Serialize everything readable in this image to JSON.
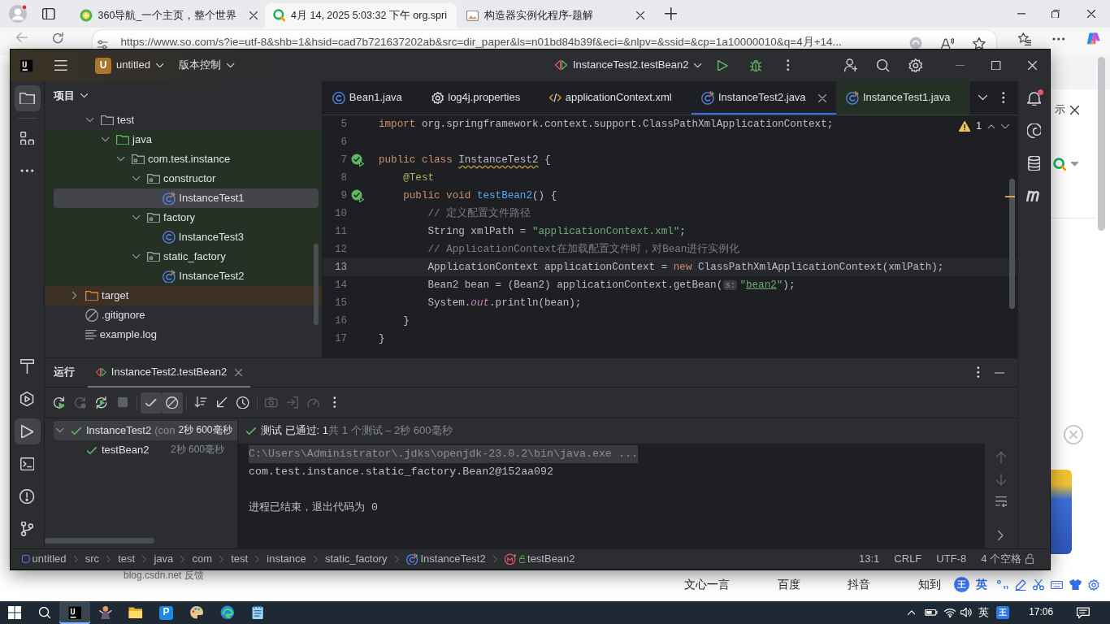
{
  "browser": {
    "tabs": [
      {
        "title": "360导航_一个主页，整个世界",
        "kind": "round",
        "selected": false
      },
      {
        "title": "4月 14, 2025 5:03:32 下午 org.spri",
        "kind": "ring",
        "selected": true
      },
      {
        "title": "构造器实例化程序-题解",
        "kind": "image",
        "selected": false
      }
    ],
    "address": "https://www.so.com/s?ie=utf-8&shb=1&hsid=cad7b721637202ab&src=dir_paper&ls=n01bd84b39f&eci=&nlpv=&ssid=&cp=1a10000010&q=4月+14..."
  },
  "ide": {
    "title_bar": {
      "project_badge": "U",
      "project": "untitled",
      "vcs": "版本控制",
      "run_config": "InstanceTest2.testBean2"
    },
    "left_tools": [
      {
        "kind": "project",
        "selected": true
      },
      {
        "kind": "structure",
        "selected": false
      },
      {
        "kind": "more",
        "selected": false
      }
    ],
    "left_tools_bottom": [
      {
        "kind": "build",
        "selected": false
      },
      {
        "kind": "services",
        "selected": false
      },
      {
        "kind": "run",
        "selected": true
      },
      {
        "kind": "terminal",
        "selected": false
      },
      {
        "kind": "problems",
        "selected": false
      },
      {
        "kind": "git",
        "selected": false
      }
    ],
    "right_tools": [
      {
        "kind": "notifications",
        "badge": true
      },
      {
        "kind": "ai-assistant",
        "badge": false
      },
      {
        "kind": "database",
        "badge": false
      },
      {
        "kind": "maven",
        "badge": false
      }
    ],
    "project": {
      "title": "项目",
      "under_scrolled_parent": [
        {
          "label": "test",
          "kind": "folder",
          "expanded": true,
          "selected": false,
          "children": [
            {
              "label": "java",
              "kind": "source-folder",
              "color": "#253124",
              "expanded": true,
              "selected": false,
              "children": [
                {
                  "label": "com.test.instance",
                  "kind": "package",
                  "expanded": true,
                  "selected": false,
                  "children": [
                    {
                      "label": "constructor",
                      "kind": "package",
                      "expanded": true,
                      "selected": false,
                      "children": [
                        {
                          "label": "InstanceTest1",
                          "kind": "test-class",
                          "selected": true
                        }
                      ]
                    },
                    {
                      "label": "factory",
                      "kind": "package",
                      "expanded": true,
                      "selected": false,
                      "children": [
                        {
                          "label": "InstanceTest3",
                          "kind": "class",
                          "selected": false
                        }
                      ]
                    },
                    {
                      "label": "static_factory",
                      "kind": "package",
                      "expanded": true,
                      "selected": false,
                      "children": [
                        {
                          "label": "InstanceTest2",
                          "kind": "test-class",
                          "selected": false
                        }
                      ]
                    }
                  ]
                }
              ]
            }
          ]
        }
      ],
      "items": [
        {
          "label": "target",
          "kind": "excluded-folder",
          "color": "#3d3024",
          "expanded": false,
          "selected": false
        },
        {
          "label": ".gitignore",
          "kind": "ignore-file",
          "selected": false
        },
        {
          "label": "example.log",
          "kind": "log-file",
          "selected": false
        }
      ]
    },
    "editor": {
      "tabs": [
        {
          "label": "Bean1.java",
          "kind": "class",
          "selected": false
        },
        {
          "label": "log4j.properties",
          "kind": "properties",
          "selected": false
        },
        {
          "label": "applicationContext.xml",
          "kind": "xml",
          "selected": false
        },
        {
          "label": "InstanceTest2.java",
          "kind": "test-class",
          "selected": true
        },
        {
          "label": "InstanceTest1.java",
          "kind": "test-class",
          "selected": false,
          "color": "#243026"
        }
      ],
      "warnings": "1",
      "lines": [
        {
          "number": "5",
          "current": false,
          "run_marker": false,
          "tokens": [
            {
              "kind": "keyword",
              "text": "import"
            },
            {
              "kind": "plain",
              "text": " org.springframework.context.support.ClassPathXmlApplicationContext;"
            }
          ]
        },
        {
          "number": "6",
          "current": false,
          "run_marker": false
        },
        {
          "number": "7",
          "current": false,
          "run_marker": true,
          "tokens": [
            {
              "kind": "keyword",
              "text": "public class "
            },
            {
              "kind": "warning",
              "text": "InstanceTest2"
            },
            {
              "kind": "plain",
              "text": " {"
            }
          ],
          "children": [
            {
              "number": "8",
              "current": false,
              "run_marker": false,
              "tokens": [
                {
                  "kind": "annotation",
                  "text": "@Test"
                }
              ]
            },
            {
              "number": "9",
              "current": false,
              "run_marker": true,
              "tokens": [
                {
                  "kind": "keyword",
                  "text": "public void "
                },
                {
                  "kind": "method",
                  "text": "testBean2"
                },
                {
                  "kind": "plain",
                  "text": "() {"
                }
              ],
              "children": [
                {
                  "number": "10",
                  "current": false,
                  "run_marker": false,
                  "tokens": [
                    {
                      "kind": "comment",
                      "text": "// 定义配置文件路径"
                    }
                  ]
                },
                {
                  "number": "11",
                  "current": false,
                  "run_marker": false,
                  "tokens": [
                    {
                      "kind": "plain",
                      "text": "String xmlPath = "
                    },
                    {
                      "kind": "string",
                      "text": "\"applicationContext.xml\""
                    },
                    {
                      "kind": "plain",
                      "text": ";"
                    }
                  ]
                },
                {
                  "number": "12",
                  "current": false,
                  "run_marker": false,
                  "tokens": [
                    {
                      "kind": "comment",
                      "text": "// ApplicationContext在加载配置文件时，对Bean进行实例化"
                    }
                  ]
                },
                {
                  "number": "13",
                  "current": true,
                  "run_marker": false,
                  "tokens": [
                    {
                      "kind": "plain",
                      "text": "ApplicationContext applicationContext = "
                    },
                    {
                      "kind": "keyword",
                      "text": "new"
                    },
                    {
                      "kind": "plain",
                      "text": " ClassPathXmlApplicationContext(xmlPath);"
                    }
                  ]
                },
                {
                  "number": "14",
                  "current": false,
                  "run_marker": false,
                  "tokens": [
                    {
                      "kind": "plain",
                      "text": "Bean2 bean = (Bean2) applicationContext.getBean("
                    },
                    {
                      "kind": "hint",
                      "text": "s:"
                    },
                    {
                      "kind": "string",
                      "text": "\""
                    },
                    {
                      "kind": "string-link",
                      "text": "bean2"
                    },
                    {
                      "kind": "string",
                      "text": "\""
                    },
                    {
                      "kind": "plain",
                      "text": ");"
                    }
                  ]
                },
                {
                  "number": "15",
                  "current": false,
                  "run_marker": false,
                  "tokens": [
                    {
                      "kind": "plain",
                      "text": "System."
                    },
                    {
                      "kind": "static-field",
                      "text": "out"
                    },
                    {
                      "kind": "plain",
                      "text": ".println(bean);"
                    }
                  ]
                }
              ]
            },
            {
              "number": "16",
              "current": false,
              "run_marker": false,
              "tokens": [
                {
                  "kind": "plain",
                  "text": "}"
                }
              ]
            }
          ]
        },
        {
          "number": "17",
          "current": false,
          "run_marker": false,
          "tokens": [
            {
              "kind": "plain",
              "text": "}"
            }
          ]
        }
      ]
    },
    "run": {
      "title": "运行",
      "tabs": [
        {
          "label": "InstanceTest2.testBean2",
          "selected": true
        }
      ],
      "toolbar": [
        [
          {
            "kind": "rerun",
            "disabled": false,
            "toggled": false
          },
          {
            "kind": "rerun-failed",
            "disabled": true,
            "toggled": false
          },
          {
            "kind": "auto-rerun",
            "disabled": false,
            "toggled": false
          },
          {
            "kind": "stop",
            "disabled": true,
            "toggled": false
          }
        ],
        [
          {
            "kind": "show-passed",
            "disabled": false,
            "toggled": true
          },
          {
            "kind": "show-ignored",
            "disabled": false,
            "toggled": true
          }
        ],
        [
          {
            "kind": "sort",
            "disabled": false,
            "toggled": false
          },
          {
            "kind": "collapse",
            "disabled": false,
            "toggled": false
          },
          {
            "kind": "history",
            "disabled": false,
            "toggled": false
          }
        ],
        [
          {
            "kind": "screenshot",
            "disabled": true,
            "toggled": false
          },
          {
            "kind": "export",
            "disabled": true,
            "toggled": false
          },
          {
            "kind": "coverage",
            "disabled": true,
            "toggled": false
          },
          {
            "kind": "more",
            "disabled": false,
            "toggled": false
          }
        ]
      ],
      "tests": [
        {
          "label": "InstanceTest2",
          "detail": "(con",
          "time": "2秒 600毫秒",
          "passed": true,
          "expanded": true,
          "selected": true,
          "children": [
            {
              "label": "testBean2",
              "time": "2秒 600毫秒",
              "passed": true,
              "selected": false
            }
          ]
        }
      ],
      "status": {
        "passed": "测试 已通过: 1",
        "summary": "共 1 个测试 – 2秒 600毫秒"
      },
      "console": [
        {
          "kind": "command",
          "text": "C:\\Users\\Administrator\\.jdks\\openjdk-23.0.2\\bin\\java.exe ..."
        },
        {
          "kind": "output",
          "text": "com.test.instance.static_factory.Bean2@152aa092"
        },
        {
          "kind": "blank"
        },
        {
          "kind": "output",
          "text": "进程已结束，退出代码为 0"
        }
      ]
    },
    "status_bar": {
      "breadcrumbs": [
        {
          "label": "untitled",
          "kind": "module"
        },
        {
          "label": "src",
          "kind": "folder"
        },
        {
          "label": "test",
          "kind": "folder"
        },
        {
          "label": "java",
          "kind": "folder"
        },
        {
          "label": "com",
          "kind": "folder"
        },
        {
          "label": "test",
          "kind": "folder"
        },
        {
          "label": "instance",
          "kind": "folder"
        },
        {
          "label": "static_factory",
          "kind": "folder"
        },
        {
          "label": "InstanceTest2",
          "kind": "test-class"
        },
        {
          "label": "testBean2",
          "kind": "method"
        }
      ],
      "position": "13:1",
      "line_separator": "CRLF",
      "encoding": "UTF-8",
      "indent": "4 个空格"
    }
  },
  "page": {
    "notice_tail": "示",
    "source": "blog.csdn.net",
    "feedback": "反馈",
    "links": [
      "文心一言",
      "百度",
      "抖音",
      "知到"
    ],
    "ime_logo": "王",
    "ime_mode": "英"
  },
  "taskbar": {
    "apps": [
      {
        "kind": "ide",
        "selected": true
      },
      {
        "kind": "figure",
        "selected": false
      },
      {
        "kind": "explorer",
        "selected": false
      },
      {
        "kind": "letter-app",
        "label": "P",
        "selected": false
      },
      {
        "kind": "paint",
        "selected": false
      },
      {
        "kind": "edge",
        "selected": false
      },
      {
        "kind": "notepad",
        "selected": false
      }
    ],
    "ime_mode": "英",
    "ime_logo": "王",
    "time": "17:06"
  }
}
